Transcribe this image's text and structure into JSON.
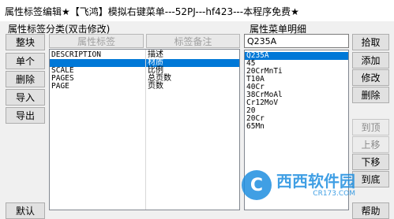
{
  "window": {
    "title": "属性标签编辑★【飞鸿】模拟右键菜单---52PJ---hf423---本程序免费★"
  },
  "left_section": {
    "label": "属性标签分类(双击修改)",
    "buttons": [
      "整块",
      "单个",
      "删除",
      "导入",
      "导出"
    ],
    "bottom_button": "默认",
    "col_tag": "属性标签",
    "col_note": "标签备注",
    "tags": [
      "DESCRIPTION",
      "",
      "SCALE",
      "PAGES",
      "PAGE"
    ],
    "notes": [
      "描述",
      "材质",
      "比例",
      "总页数",
      "页数"
    ],
    "selected_index": 1
  },
  "right_section": {
    "label": "属性菜单明细",
    "input_value": "Q235A",
    "items": [
      "Q235A",
      "45",
      "20CrMnTi",
      "T10A",
      "40Cr",
      "38CrMoAl",
      "Cr12MoV",
      "20",
      "20Cr",
      "65Mn"
    ],
    "selected_index": 0,
    "buttons_enabled": [
      "拾取",
      "添加",
      "修改",
      "删除"
    ],
    "buttons_disabled": [
      "到顶",
      "上移"
    ],
    "button_down": "下移",
    "button_bottom": "到底",
    "button_help": "帮助"
  },
  "watermark": {
    "text": "西西软件园",
    "sub": "CR173.COM",
    "glyph": "C"
  },
  "colors": {
    "selection": "#0078d7",
    "window_bg": "#f0f0f0"
  }
}
